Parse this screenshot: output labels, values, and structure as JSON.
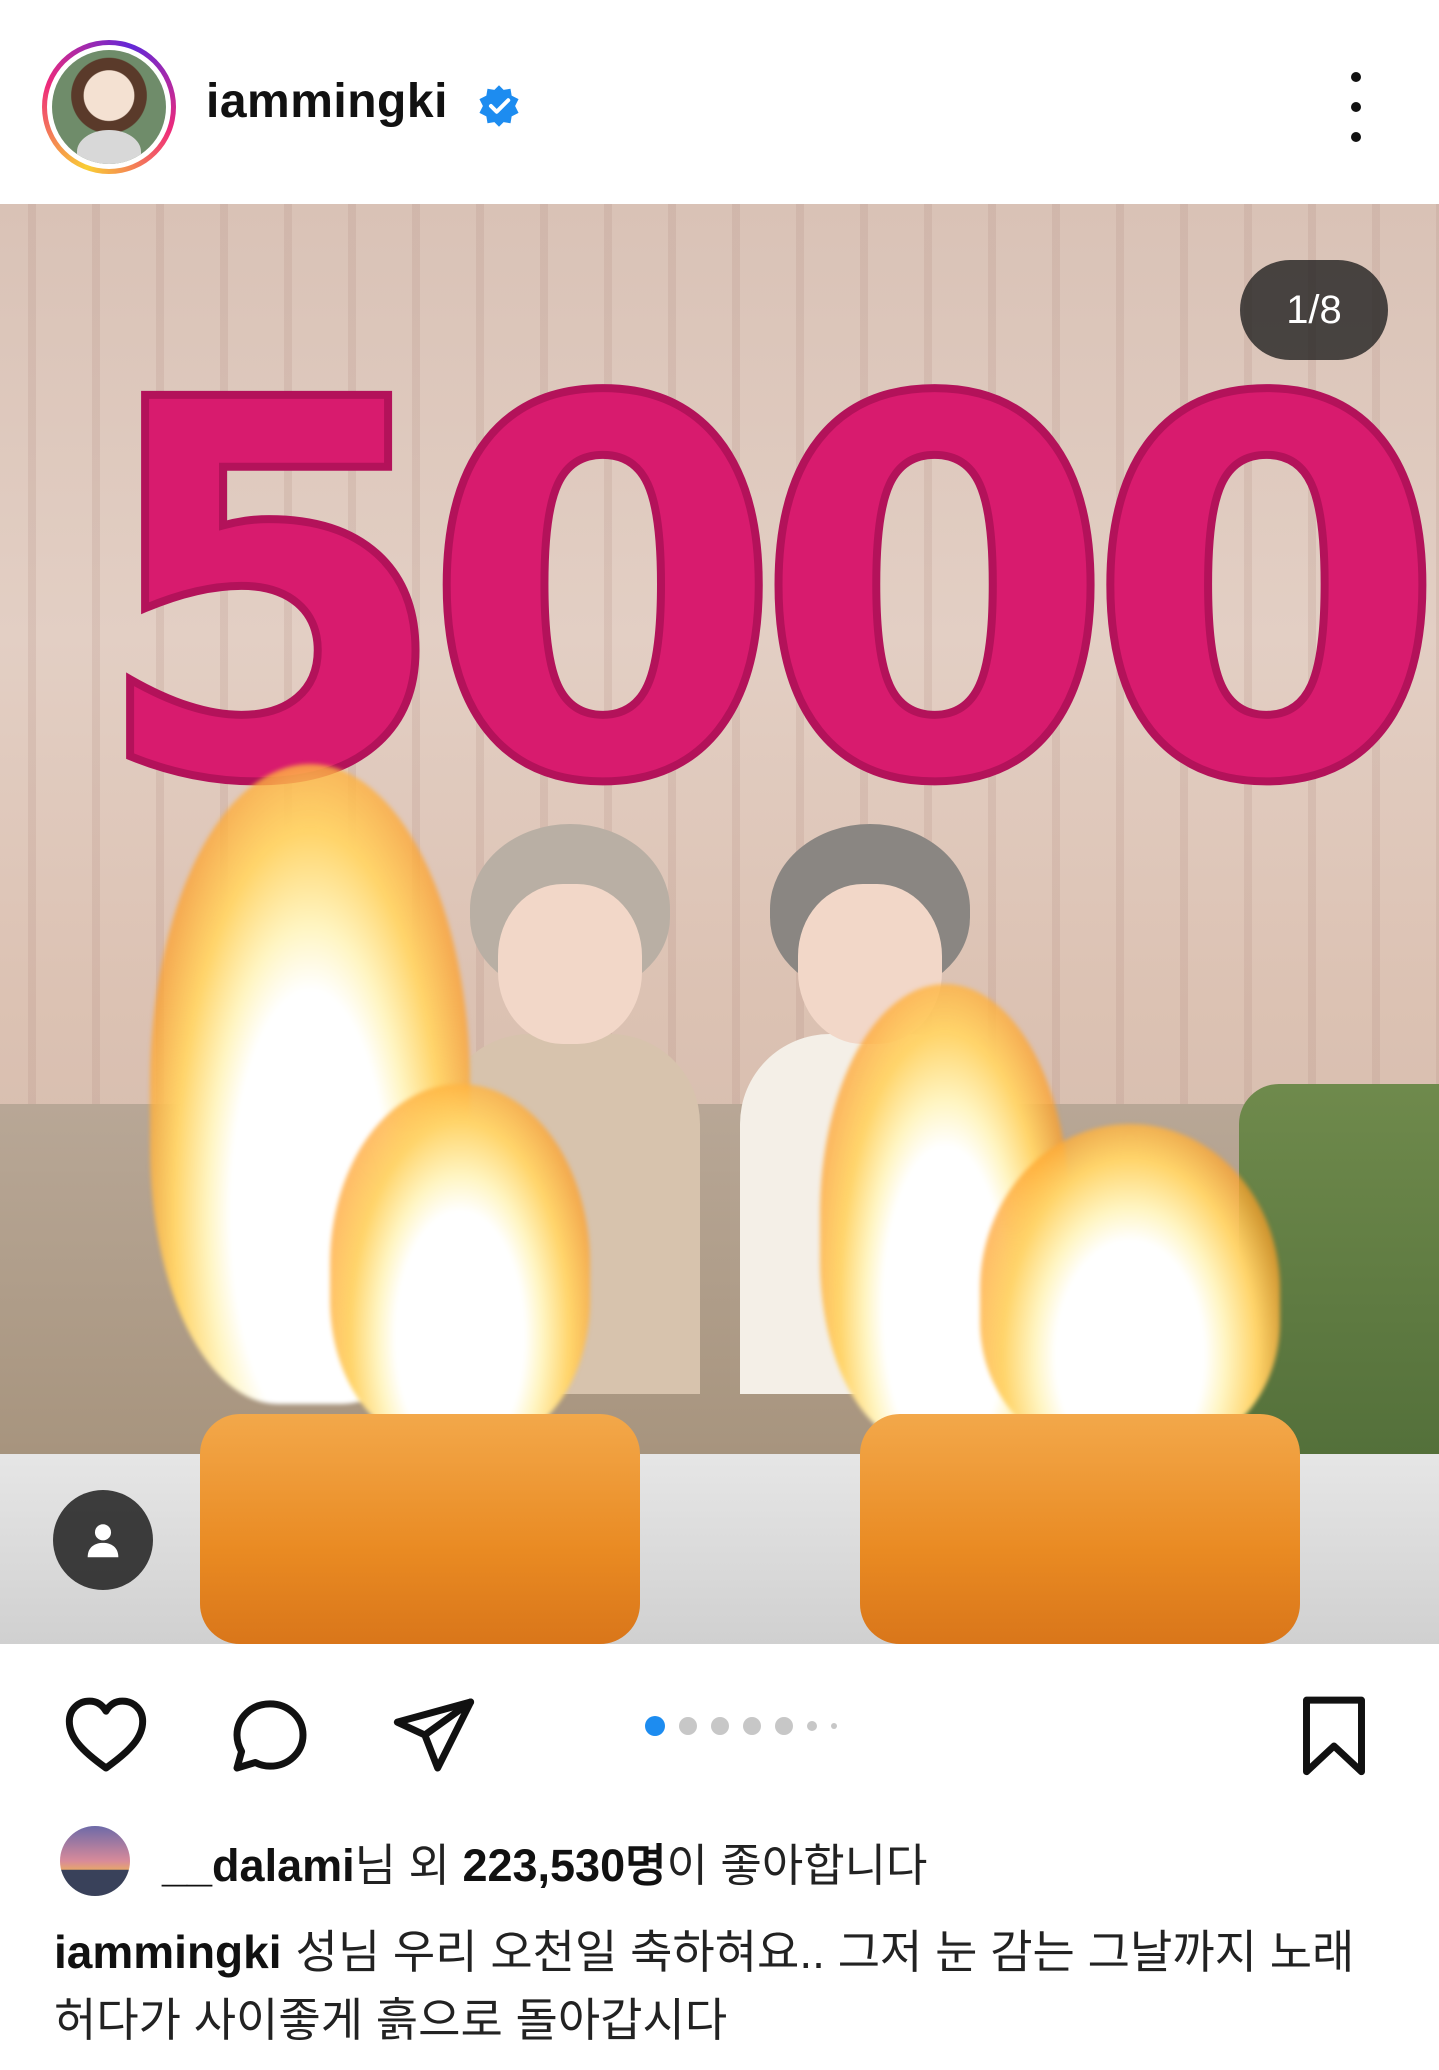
{
  "post": {
    "username": "iammingki",
    "verified": true,
    "image_counter": "1/8",
    "balloon_text": "5000",
    "carousel": {
      "total": 8,
      "current": 1
    },
    "likes": {
      "liker_username": "__dalami",
      "suffix_1": "님 외 ",
      "count": "223,530명",
      "suffix_2": "이 좋아합니다"
    },
    "caption": {
      "username": "iammingki",
      "text": "성님 우리 오천일 축하혀요.. 그저 눈 감는 그날까지 노래 허다가 사이좋게 흙으로 돌아갑시다"
    }
  },
  "icons": {
    "verified": "verified-badge-icon",
    "more": "more-options-icon",
    "like": "heart-icon",
    "comment": "comment-icon",
    "share": "send-icon",
    "save": "bookmark-icon",
    "tag": "person-tag-icon"
  },
  "colors": {
    "accent_blue": "#1d8cf0",
    "balloon_pink": "#d81b6e",
    "text": "#111111"
  }
}
